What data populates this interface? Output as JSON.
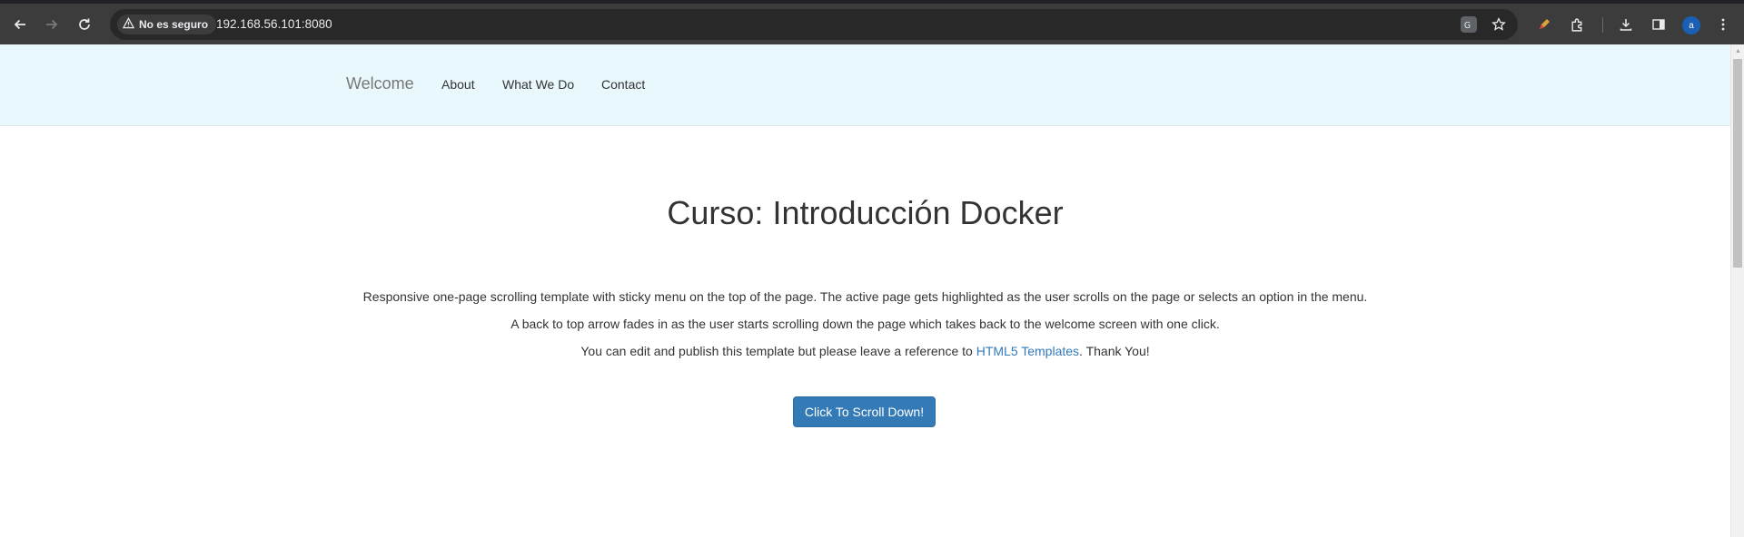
{
  "browser": {
    "security_label": "No es seguro",
    "url": "192.168.56.101:8080",
    "avatar_initial": "a",
    "icons": {
      "back": "arrow-left-icon",
      "forward": "arrow-right-icon",
      "reload": "reload-icon",
      "translate": "translate-icon",
      "bookmark": "star-icon",
      "extension_pen": "pen-icon",
      "extensions": "puzzle-icon",
      "downloads": "download-icon",
      "side_panel": "side-panel-icon",
      "menu": "kebab-menu-icon"
    }
  },
  "site_nav": {
    "brand": "Welcome",
    "links": [
      "About",
      "What We Do",
      "Contact"
    ]
  },
  "hero": {
    "title": "Curso: Introducción Docker",
    "line1": "Responsive one-page scrolling template with sticky menu on the top of the page. The active page gets highlighted as the user scrolls on the page or selects an option in the menu.",
    "line2": "A back to top arrow fades in as the user starts scrolling down the page which takes back to the welcome screen with one click.",
    "line3_prefix": "You can edit and publish this template but please leave a reference to ",
    "line3_link": "HTML5 Templates",
    "line3_suffix": ". Thank You!",
    "button": "Click To Scroll Down!"
  },
  "colors": {
    "nav_background": "#e8f8fd",
    "link": "#337ab7",
    "button": "#337ab7",
    "browser_toolbar": "#3c3c3c"
  }
}
